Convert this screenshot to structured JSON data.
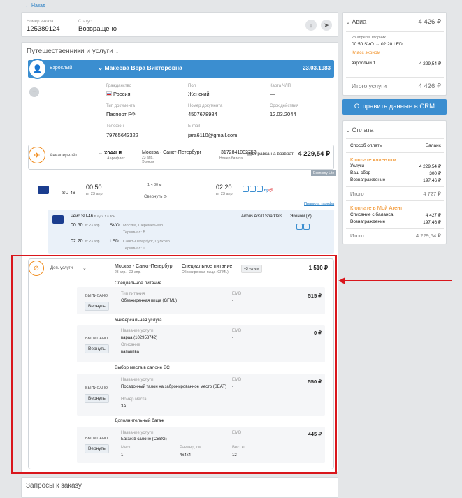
{
  "back": "← Назад",
  "order": {
    "num_label": "Номер заказа",
    "num": "125389124",
    "status_label": "Статус",
    "status": "Возвращено"
  },
  "travellers": {
    "title": "Путешественники и услуги",
    "type": "Взрослый",
    "name": "Макеева Вера Викторовна",
    "dob": "23.03.1983",
    "fields": [
      {
        "l": "Гражданство",
        "v": "Россия"
      },
      {
        "l": "Пол",
        "v": "Женский"
      },
      {
        "l": "Карта ЧЛП",
        "v": "—"
      },
      {
        "l": "Тип документа",
        "v": "Паспорт РФ"
      },
      {
        "l": "Номер документа",
        "v": "4507678984"
      },
      {
        "l": "Срок действия",
        "v": "12.03.2044"
      },
      {
        "l": "Телефон",
        "v": "79765643322"
      },
      {
        "l": "E-mail",
        "v": "jara6110@gmail.com"
      }
    ]
  },
  "flight": {
    "label": "Авиаперелёт",
    "pnr": "X044LR",
    "pnr_sub": "Аэрофлот",
    "route": "Москва - Санкт-Петербург",
    "route_sub1": "23 апр.",
    "route_sub2": "Эконом",
    "ticket": "3172841002752",
    "ticket_sub": "Номер билета",
    "ref": "Справка на возврат",
    "price": "4 229,54 ₽",
    "tag": "Economy Lite",
    "seg_code": "SU-46",
    "dep": "00:50",
    "dep_d": "вт 23 апр.",
    "dur": "1 ч 30 м",
    "arr": "02:20",
    "arr_d": "вт 23 апр.",
    "fold": "Свернуть ⊙",
    "rules": "Правила тарифа",
    "d_flight": "Рейс SU-46",
    "d_path": "В пути 1 ч 30м",
    "d_plane": "Airbus A320 Sharklets",
    "d_class": "Эконом (Y)",
    "d_dep": "00:50",
    "d_dep_d": "вт 23 апр.",
    "d_dep_c": "SVO",
    "d_dep_a": "Москва, Шереметьево",
    "d_dep_t": "Терминал: B",
    "d_arr": "02:20",
    "d_arr_d": "вт 23 апр.",
    "d_arr_c": "LED",
    "d_arr_a": "Санкт-Петербург, Пулково",
    "d_arr_t": "Терминал: 1"
  },
  "extra": {
    "label": "Доп. услуги",
    "route": "Москва - Санкт-Петербург",
    "route_sub": "23 апр. - 23 апр.",
    "svc": "Специальное питание",
    "svc_sub": "Обезжиренная пища (GFML)",
    "more": "+3 услуги",
    "total": "1 510 ₽",
    "status": "ВЫПИСАНО",
    "ret": "Вернуть",
    "emd": "EMD",
    "dash": "-",
    "s1": {
      "title": "Специальное питание",
      "l1": "Тип питания",
      "v1": "Обезжиренная пища (GFML)",
      "price": "515 ₽"
    },
    "s2": {
      "title": "Универсальная услуга",
      "l1": "Название услуги",
      "v1": "вараа (102958742)",
      "l2": "Описание",
      "v2": "вапавпва",
      "price": "0 ₽"
    },
    "s3": {
      "title": "Выбор места в салоне ВС",
      "l1": "Название услуги",
      "v1": "Посадочный талон на забронированное место (SEAT)",
      "l2": "Номер места",
      "v2": "3А",
      "price": "550 ₽"
    },
    "s4": {
      "title": "Дополнительный багаж",
      "l1": "Название услуги",
      "v1": "Багаж в салоне (CBBG)",
      "l2": "Мест",
      "v2": "1",
      "l3": "Размер, см",
      "v3": "4x4x4",
      "l4": "Вес, кг",
      "v4": "12",
      "price": "445 ₽"
    }
  },
  "requests": "Запросы к заказу",
  "side": {
    "avia": "Авиа",
    "avia_price": "4 426 ₽",
    "date": "23 апреля, вторник",
    "dep": "00:50 SVO",
    "arr": "02:20 LED",
    "cls": "Класс эконом",
    "pax": "взрослый 1",
    "pax_price": "4 229,54 ₽",
    "total_l": "Итого услуги",
    "total_v": "4 426 ₽",
    "crm": "Отправить данные в CRM",
    "pay": "Оплата",
    "pay_m": "Способ оплаты",
    "pay_b": "Баланс",
    "to_client": "К оплате клиентом",
    "c1": "Услуги",
    "c1v": "4 229,54 ₽",
    "c2": "Ваш сбор",
    "c2v": "300 ₽",
    "c3": "Вознаграждение",
    "c3v": "197,46 ₽",
    "it1": "Итого",
    "it1v": "4 727 ₽",
    "to_agent": "К оплате в Мой Агент",
    "a1": "Списание с баланса",
    "a1v": "4 427 ₽",
    "a2": "Вознаграждение",
    "a2v": "197,46 ₽",
    "it2": "Итого",
    "it2v": "4 229,54 ₽"
  },
  "colors": {
    "accent": "#3b8ed0",
    "highlight": "#d9161c",
    "orange": "#f08a1a"
  }
}
